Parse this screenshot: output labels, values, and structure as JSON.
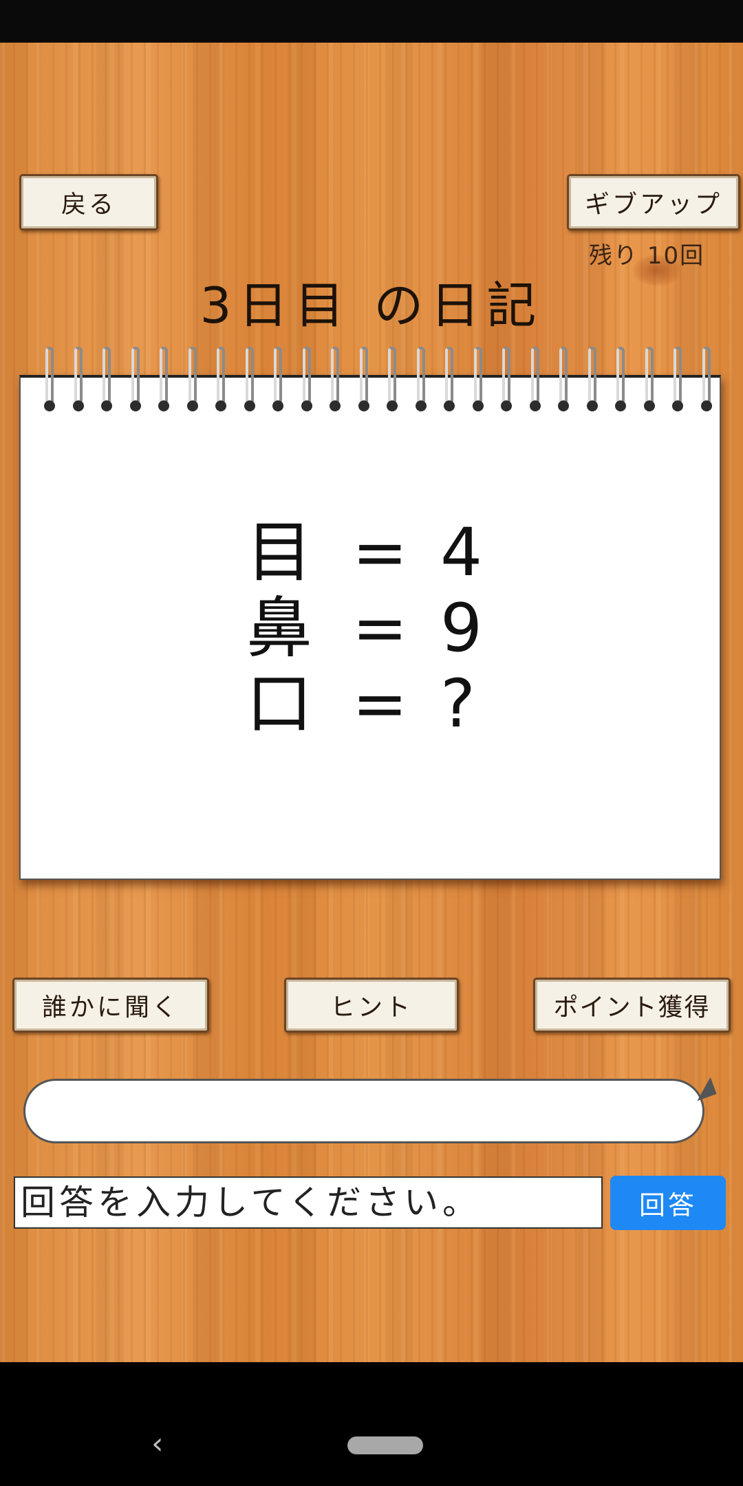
{
  "header": {
    "back_label": "戻る",
    "giveup_label": "ギブアップ",
    "remaining_label": "残り 10回",
    "day_title": "3日目 の日記"
  },
  "puzzle": {
    "rows": [
      {
        "kanji": "目",
        "equals": "=",
        "value": "4"
      },
      {
        "kanji": "鼻",
        "equals": "=",
        "value": "9"
      },
      {
        "kanji": "口",
        "equals": "=",
        "value": "?"
      }
    ]
  },
  "actions": {
    "ask_label": "誰かに聞く",
    "hint_label": "ヒント",
    "points_label": "ポイント獲得"
  },
  "answer": {
    "placeholder": "回答を入力してください。",
    "value": "",
    "submit_label": "回答"
  },
  "colors": {
    "submit_button": "#1e88f5",
    "wood": "#dc8a3e",
    "button_face": "#f6f1e6",
    "button_border": "#6b4424"
  },
  "icons": {
    "nav_back": "chevron-left-icon",
    "nav_home": "home-pill-icon"
  }
}
